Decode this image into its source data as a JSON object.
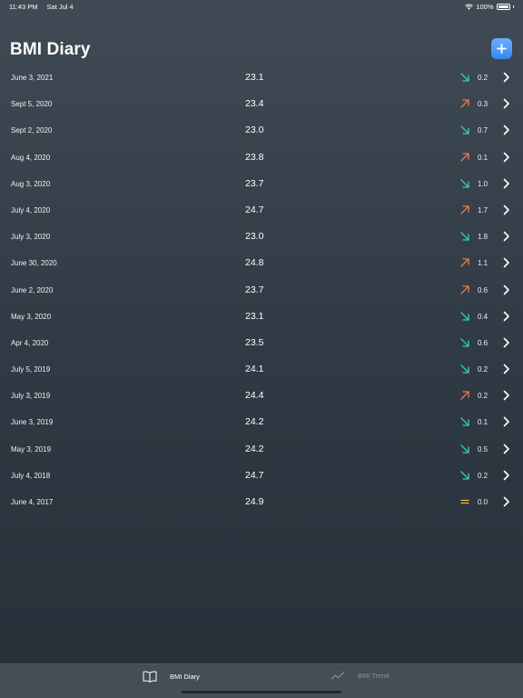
{
  "status_bar": {
    "time": "11:43 PM",
    "date": "Sat Jul 4",
    "battery": "100%"
  },
  "header": {
    "title": "BMI Diary",
    "add_button_icon": "plus-icon"
  },
  "colors": {
    "up": "#f07a4a",
    "down": "#2fd1c0",
    "equal": "#f0b43c",
    "accent": "#3a86f0"
  },
  "entries": [
    {
      "date": "June 3, 2021",
      "bmi": "23.1",
      "trend": "down",
      "change": "0.2"
    },
    {
      "date": "Sept 5, 2020",
      "bmi": "23.4",
      "trend": "up",
      "change": "0.3"
    },
    {
      "date": "Sept 2, 2020",
      "bmi": "23.0",
      "trend": "down",
      "change": "0.7"
    },
    {
      "date": "Aug 4, 2020",
      "bmi": "23.8",
      "trend": "up",
      "change": "0.1"
    },
    {
      "date": "Aug 3, 2020",
      "bmi": "23.7",
      "trend": "down",
      "change": "1.0"
    },
    {
      "date": "July 4, 2020",
      "bmi": "24.7",
      "trend": "up",
      "change": "1.7"
    },
    {
      "date": "July 3, 2020",
      "bmi": "23.0",
      "trend": "down",
      "change": "1.8"
    },
    {
      "date": "June 30, 2020",
      "bmi": "24.8",
      "trend": "up",
      "change": "1.1"
    },
    {
      "date": "June 2, 2020",
      "bmi": "23.7",
      "trend": "up",
      "change": "0.6"
    },
    {
      "date": "May 3, 2020",
      "bmi": "23.1",
      "trend": "down",
      "change": "0.4"
    },
    {
      "date": "Apr 4, 2020",
      "bmi": "23.5",
      "trend": "down",
      "change": "0.6"
    },
    {
      "date": "July 5, 2019",
      "bmi": "24.1",
      "trend": "down",
      "change": "0.2"
    },
    {
      "date": "July 3, 2019",
      "bmi": "24.4",
      "trend": "up",
      "change": "0.2"
    },
    {
      "date": "June 3, 2019",
      "bmi": "24.2",
      "trend": "down",
      "change": "0.1"
    },
    {
      "date": "May 3, 2019",
      "bmi": "24.2",
      "trend": "down",
      "change": "0.5"
    },
    {
      "date": "July 4, 2018",
      "bmi": "24.7",
      "trend": "down",
      "change": "0.2"
    },
    {
      "date": "June 4, 2017",
      "bmi": "24.9",
      "trend": "equal",
      "change": "0.0"
    }
  ],
  "tabs": [
    {
      "label": "BMI Diary",
      "icon": "book-icon",
      "selected": true
    },
    {
      "label": "BMI Trend",
      "icon": "trend-chart-icon",
      "selected": false
    }
  ]
}
